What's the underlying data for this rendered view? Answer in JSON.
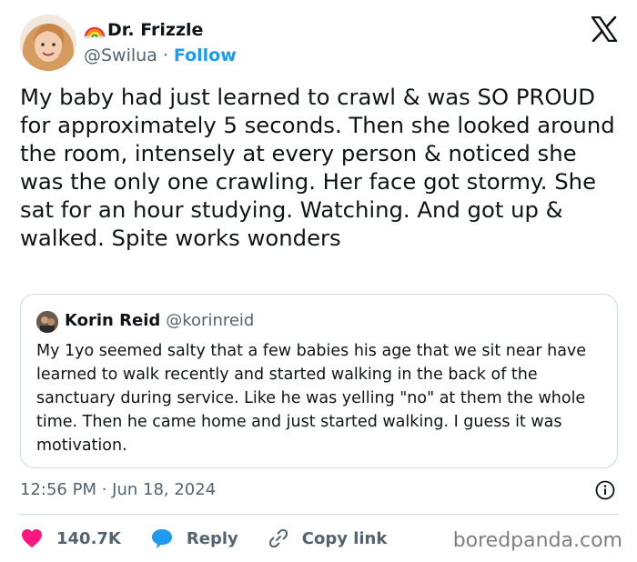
{
  "author": {
    "display_name": "Dr. Frizzle",
    "handle": "@Swilua",
    "separator": "·",
    "follow_label": "Follow"
  },
  "tweet": {
    "text": "My baby had just learned to crawl & was SO PROUD for approximately 5 seconds. Then she looked around the room, intensely at every person & noticed she was the only one crawling. Her face got stormy. She sat for an hour studying. Watching. And got up & walked. Spite works wonders"
  },
  "quote": {
    "display_name": "Korin Reid",
    "handle": "@korinreid",
    "text": "My 1yo seemed salty that a few babies his age that we sit near have learned to walk recently and started walking in the back of the sanctuary during service. Like he was yelling \"no\" at them the whole time. Then he came home and just started walking. I guess it was motivation."
  },
  "meta": {
    "timestamp": "12:56 PM · Jun 18, 2024"
  },
  "actions": {
    "likes": "140.7K",
    "reply_label": "Reply",
    "copy_label": "Copy link"
  },
  "watermark": "boredpanda.com",
  "colors": {
    "accent": "#1d9bf0",
    "like": "#f91880",
    "text": "#0f1419",
    "secondary": "#536471",
    "border": "#cfd9de"
  },
  "icons": [
    "rainbow-icon",
    "x-logo-icon",
    "info-icon",
    "heart-icon",
    "reply-bubble-icon",
    "link-icon"
  ]
}
